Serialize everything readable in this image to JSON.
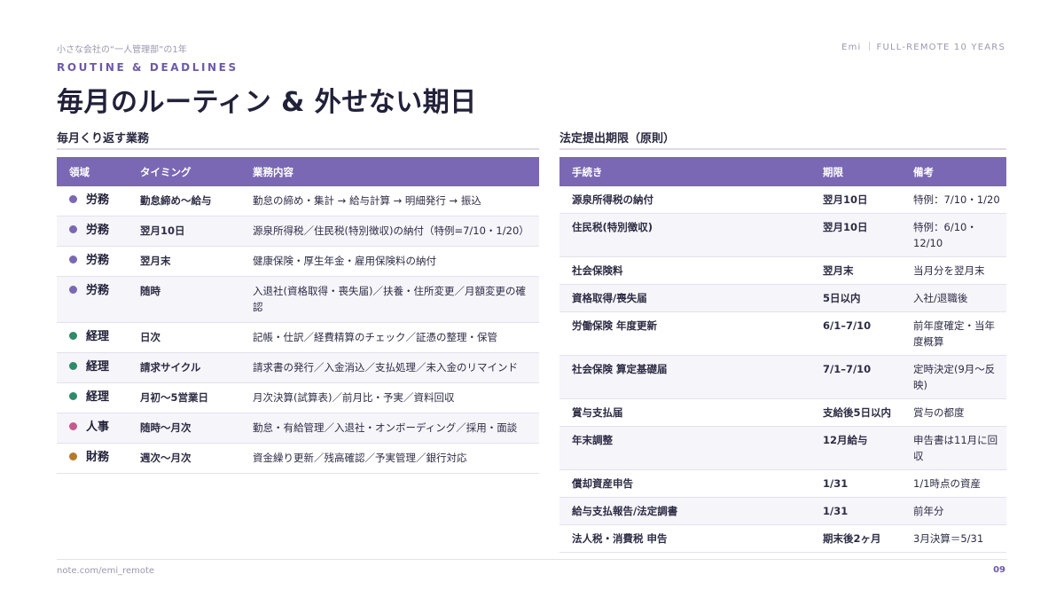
{
  "header": {
    "series": "小さな会社の“一人管理部”の1年",
    "author": "Emi",
    "tagline": "FULL-REMOTE 10 YEARS"
  },
  "kicker": "ROUTINE & DEADLINES",
  "title": "毎月のルーティン & 外せない期日",
  "colors": {
    "labor": "#7a68b4",
    "accounting": "#2f8a6a",
    "hr": "#c65a8c",
    "finance": "#b8782a",
    "header_bg": "#7a68b4"
  },
  "left": {
    "section_title": "毎月くり返す業務",
    "columns": [
      "領域",
      "タイミング",
      "業務内容"
    ],
    "rows": [
      {
        "area": "労務",
        "color": "#7a68b4",
        "timing": "勤怠締め〜給与",
        "content": "勤怠の締め・集計 → 給与計算 → 明細発行 → 振込"
      },
      {
        "area": "労務",
        "color": "#7a68b4",
        "timing": "翌月10日",
        "content": "源泉所得税／住民税(特別徴収)の納付（特例=7/10・1/20）"
      },
      {
        "area": "労務",
        "color": "#7a68b4",
        "timing": "翌月末",
        "content": "健康保険・厚生年金・雇用保険料の納付"
      },
      {
        "area": "労務",
        "color": "#7a68b4",
        "timing": "随時",
        "content": "入退社(資格取得・喪失届)／扶養・住所変更／月額変更の確認"
      },
      {
        "area": "経理",
        "color": "#2f8a6a",
        "timing": "日次",
        "content": "記帳・仕訳／経費精算のチェック／証憑の整理・保管"
      },
      {
        "area": "経理",
        "color": "#2f8a6a",
        "timing": "請求サイクル",
        "content": "請求書の発行／入金消込／支払処理／未入金のリマインド"
      },
      {
        "area": "経理",
        "color": "#2f8a6a",
        "timing": "月初〜5営業日",
        "content": "月次決算(試算表)／前月比・予実／資料回収"
      },
      {
        "area": "人事",
        "color": "#c65a8c",
        "timing": "随時〜月次",
        "content": "勤怠・有給管理／入退社・オンボーディング／採用・面談"
      },
      {
        "area": "財務",
        "color": "#b8782a",
        "timing": "週次〜月次",
        "content": "資金繰り更新／残高確認／予実管理／銀行対応"
      }
    ]
  },
  "right": {
    "section_title": "法定提出期限（原則）",
    "columns": [
      "手続き",
      "期限",
      "備考"
    ],
    "rows": [
      {
        "proc": "源泉所得税の納付",
        "deadline": "翌月10日",
        "note": "特例：7/10・1/20"
      },
      {
        "proc": "住民税(特別徴収)",
        "deadline": "翌月10日",
        "note": "特例：6/10・12/10"
      },
      {
        "proc": "社会保険料",
        "deadline": "翌月末",
        "note": "当月分を翌月末"
      },
      {
        "proc": "資格取得/喪失届",
        "deadline": "5日以内",
        "note": "入社/退職後"
      },
      {
        "proc": "労働保険 年度更新",
        "deadline": "6/1–7/10",
        "note": "前年度確定・当年度概算"
      },
      {
        "proc": "社会保険 算定基礎届",
        "deadline": "7/1–7/10",
        "note": "定時決定(9月〜反映)"
      },
      {
        "proc": "賞与支払届",
        "deadline": "支給後5日以内",
        "note": "賞与の都度"
      },
      {
        "proc": "年末調整",
        "deadline": "12月給与",
        "note": "申告書は11月に回収"
      },
      {
        "proc": "償却資産申告",
        "deadline": "1/31",
        "note": "1/1時点の資産"
      },
      {
        "proc": "給与支払報告/法定調書",
        "deadline": "1/31",
        "note": "前年分"
      },
      {
        "proc": "法人税・消費税 申告",
        "deadline": "期末後2ヶ月",
        "note": "3月決算＝5/31"
      }
    ]
  },
  "footer": {
    "source": "note.com/emi_remote",
    "page": "09"
  }
}
